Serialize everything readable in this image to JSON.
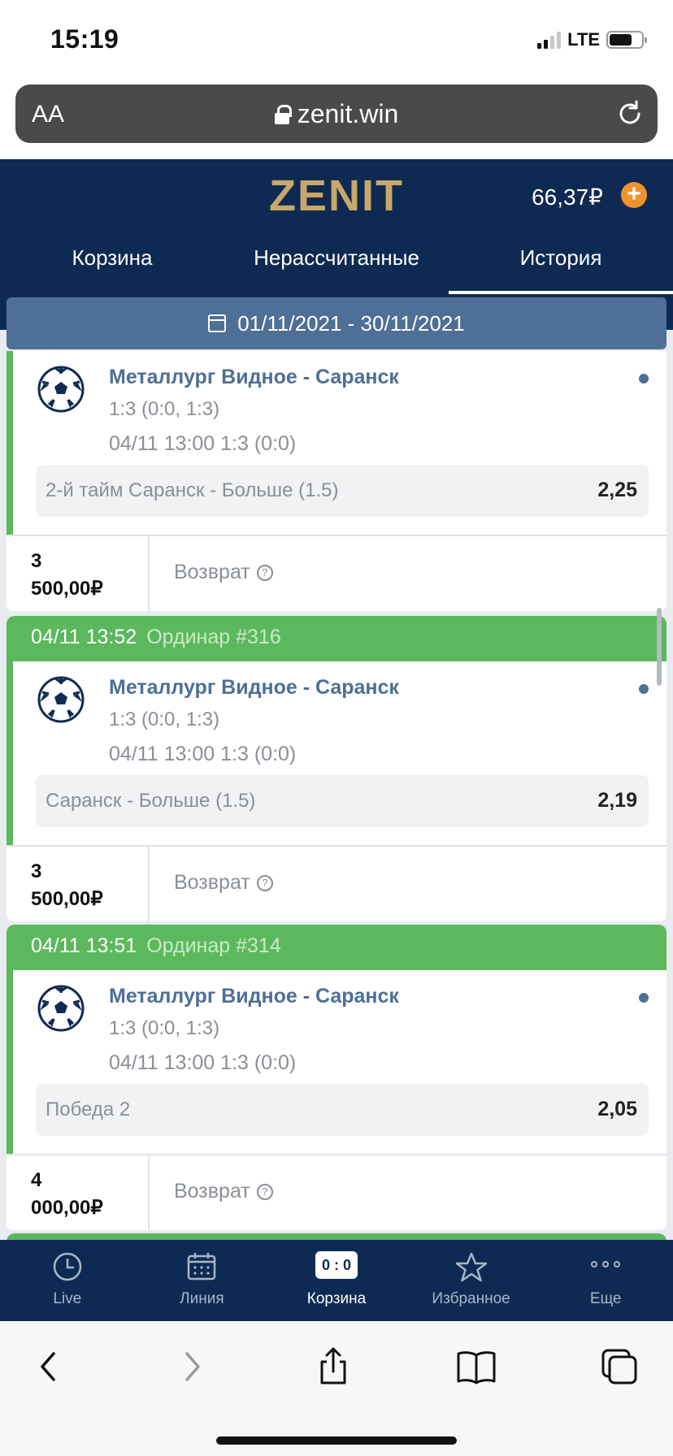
{
  "status_bar": {
    "time": "15:19",
    "network": "LTE"
  },
  "browser": {
    "text_size_label": "AA",
    "url": "zenit.win"
  },
  "app": {
    "logo": "ZENIT",
    "balance": "66,37₽",
    "tabs": [
      "Корзина",
      "Нерассчитанные",
      "История"
    ],
    "active_tab": "История",
    "date_range": "01/11/2021 - 30/11/2021"
  },
  "bets": [
    {
      "match": "Металлург Видное - Саранск",
      "score": "1:3 (0:0, 1:3)",
      "datetime": "04/11 13:00 1:3 (0:0)",
      "outcome": "2-й тайм Саранск - Больше (1.5)",
      "odds": "2,25",
      "stake_line1": "3",
      "stake_line2": "500,00₽",
      "status": "Возврат"
    },
    {
      "header_time": "04/11 13:52",
      "header_ordinar": "Ординар #316",
      "match": "Металлург Видное - Саранск",
      "score": "1:3 (0:0, 1:3)",
      "datetime": "04/11 13:00 1:3 (0:0)",
      "outcome": "Саранск - Больше (1.5)",
      "odds": "2,19",
      "stake_line1": "3",
      "stake_line2": "500,00₽",
      "status": "Возврат"
    },
    {
      "header_time": "04/11 13:51",
      "header_ordinar": "Ординар #314",
      "match": "Металлург Видное - Саранск",
      "score": "1:3 (0:0, 1:3)",
      "datetime": "04/11 13:00 1:3 (0:0)",
      "outcome": "Победа 2",
      "odds": "2,05",
      "stake_line1": "4",
      "stake_line2": "000,00₽",
      "status": "Возврат"
    }
  ],
  "bottom_nav": {
    "items": [
      "Live",
      "Линия",
      "Корзина",
      "Избранное",
      "Еще"
    ],
    "active": "Корзина",
    "score_badge": "0 : 0"
  },
  "colors": {
    "header_bg": "#0f2a52",
    "logo_gold": "#c7a86a",
    "accent_blue": "#4e6f96",
    "win_green": "#5cb85c",
    "plus_orange": "#f0922b"
  }
}
